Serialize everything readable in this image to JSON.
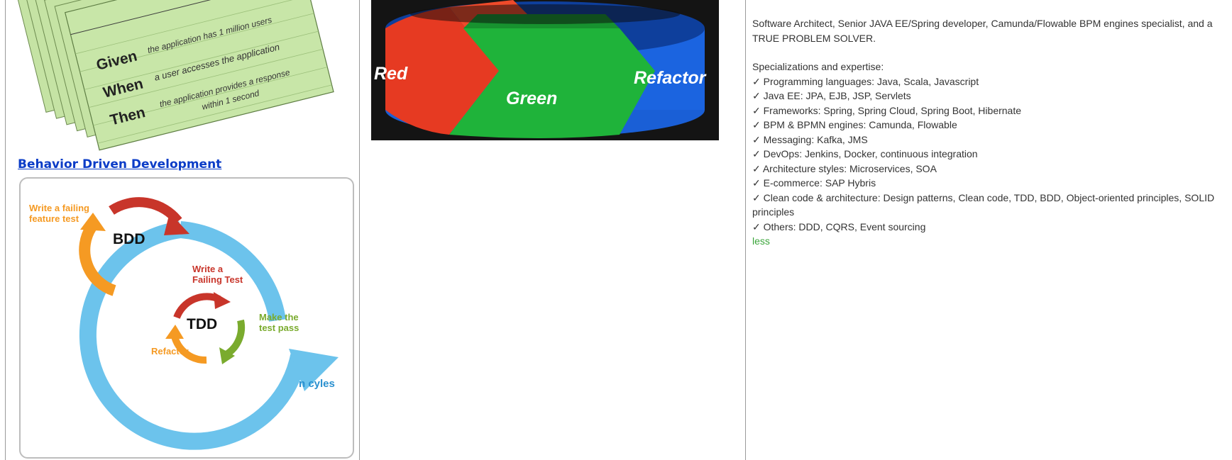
{
  "left": {
    "cards_image": {
      "given_label": "Given",
      "given_text": "the application has 1 million users",
      "when_label": "When",
      "when_text": "a user accesses the application",
      "then_label": "Then",
      "then_text_1": "the application provides a response",
      "then_text_2": "within 1 second"
    },
    "bdd_link": "Behavior Driven Development",
    "diagram": {
      "write_failing_feature_1": "Write a failing",
      "write_failing_feature_2": "feature test",
      "bdd": "BDD",
      "write_failing_test_1": "Write a",
      "write_failing_test_2": "Failing Test",
      "tdd": "TDD",
      "make_pass_1": "Make the",
      "make_pass_2": "test pass",
      "refactor": "Refactor",
      "n_cycles": "n cyles"
    }
  },
  "middle": {
    "rgr_image": {
      "red": "Red",
      "green": "Green",
      "refactor": "Refactor"
    }
  },
  "right": {
    "intro": "Software Architect, Senior JAVA EE/Spring developer, Camunda/Flowable BPM engines specialist, and a TRUE PROBLEM SOLVER.",
    "spec_heading": "Specializations and expertise:",
    "items": [
      "✓ Programming languages: Java, Scala, Javascript",
      "✓ Java EE: JPA, EJB, JSP, Servlets",
      "✓ Frameworks: Spring, Spring Cloud, Spring Boot, Hibernate",
      "✓ BPM & BPMN engines: Camunda, Flowable",
      "✓ Messaging: Kafka, JMS",
      "✓ DevOps: Jenkins, Docker, continuous integration",
      "✓ Architecture styles: Microservices, SOA",
      "✓ E-commerce: SAP Hybris",
      "✓ Clean code & architecture: Design patterns, Clean code, TDD, BDD, Object-oriented principles, SOLID principles",
      "✓ Others: DDD, CQRS, Event sourcing"
    ],
    "less": "less"
  },
  "colors": {
    "link": "#0b3cc7",
    "less": "#3aa53a",
    "card_green": "#c5e3a4",
    "bdd_blue": "#6cc3ec",
    "bdd_orange": "#f59a23",
    "tdd_red": "#c8352a",
    "tdd_green": "#7aab2e"
  }
}
